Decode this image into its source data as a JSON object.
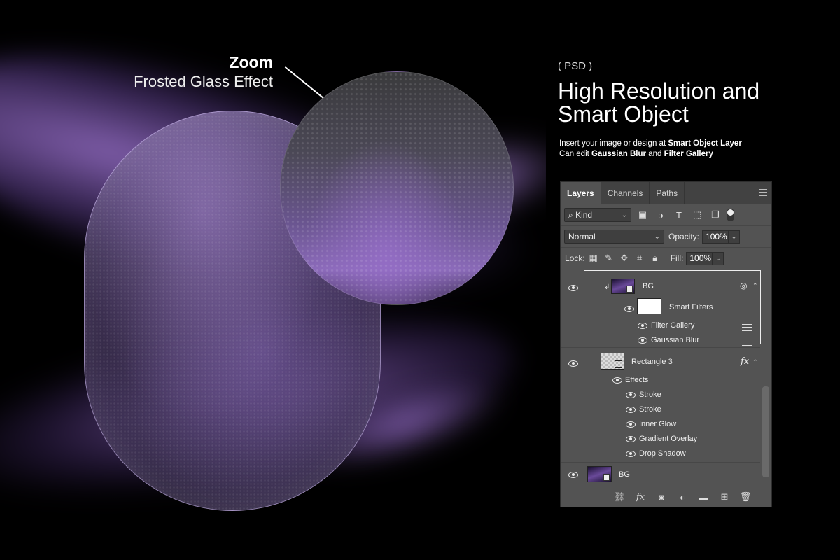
{
  "callout": {
    "title": "Zoom",
    "subtitle": "Frosted Glass Effect"
  },
  "info": {
    "tag": "( PSD )",
    "headline_line1": "High Resolution and",
    "headline_line2": "Smart Object",
    "desc_line1_prefix": "Insert your image or design at ",
    "desc_line1_bold": "Smart Object Layer",
    "desc_line2_prefix": "Can edit ",
    "desc_line2_bold1": "Gaussian Blur",
    "desc_line2_mid": " and ",
    "desc_line2_bold2": "Filter Gallery"
  },
  "panel": {
    "tabs": [
      "Layers",
      "Channels",
      "Paths"
    ],
    "active_tab": "Layers",
    "filter_kind": "Kind",
    "blend_mode": "Normal",
    "opacity_label": "Opacity:",
    "opacity_value": "100%",
    "lock_label": "Lock:",
    "fill_label": "Fill:",
    "fill_value": "100%",
    "layers": {
      "bg_smart": "BG",
      "smart_filters": "Smart Filters",
      "filter_gallery": "Filter Gallery",
      "gaussian_blur": "Gaussian Blur",
      "rectangle": "Rectangle 3",
      "fx": "fx",
      "effects": "Effects",
      "effect_items": [
        "Stroke",
        "Stroke",
        "Inner Glow",
        "Gradient Overlay",
        "Drop Shadow"
      ],
      "bg": "BG"
    },
    "bottom_icons": [
      "link-icon",
      "fx-icon",
      "mask-icon",
      "adjustment-icon",
      "folder-icon",
      "new-layer-icon",
      "trash-icon"
    ]
  },
  "colors": {
    "accent_purple": "#8a6ab8",
    "panel_bg": "#535353",
    "background": "#000000"
  }
}
